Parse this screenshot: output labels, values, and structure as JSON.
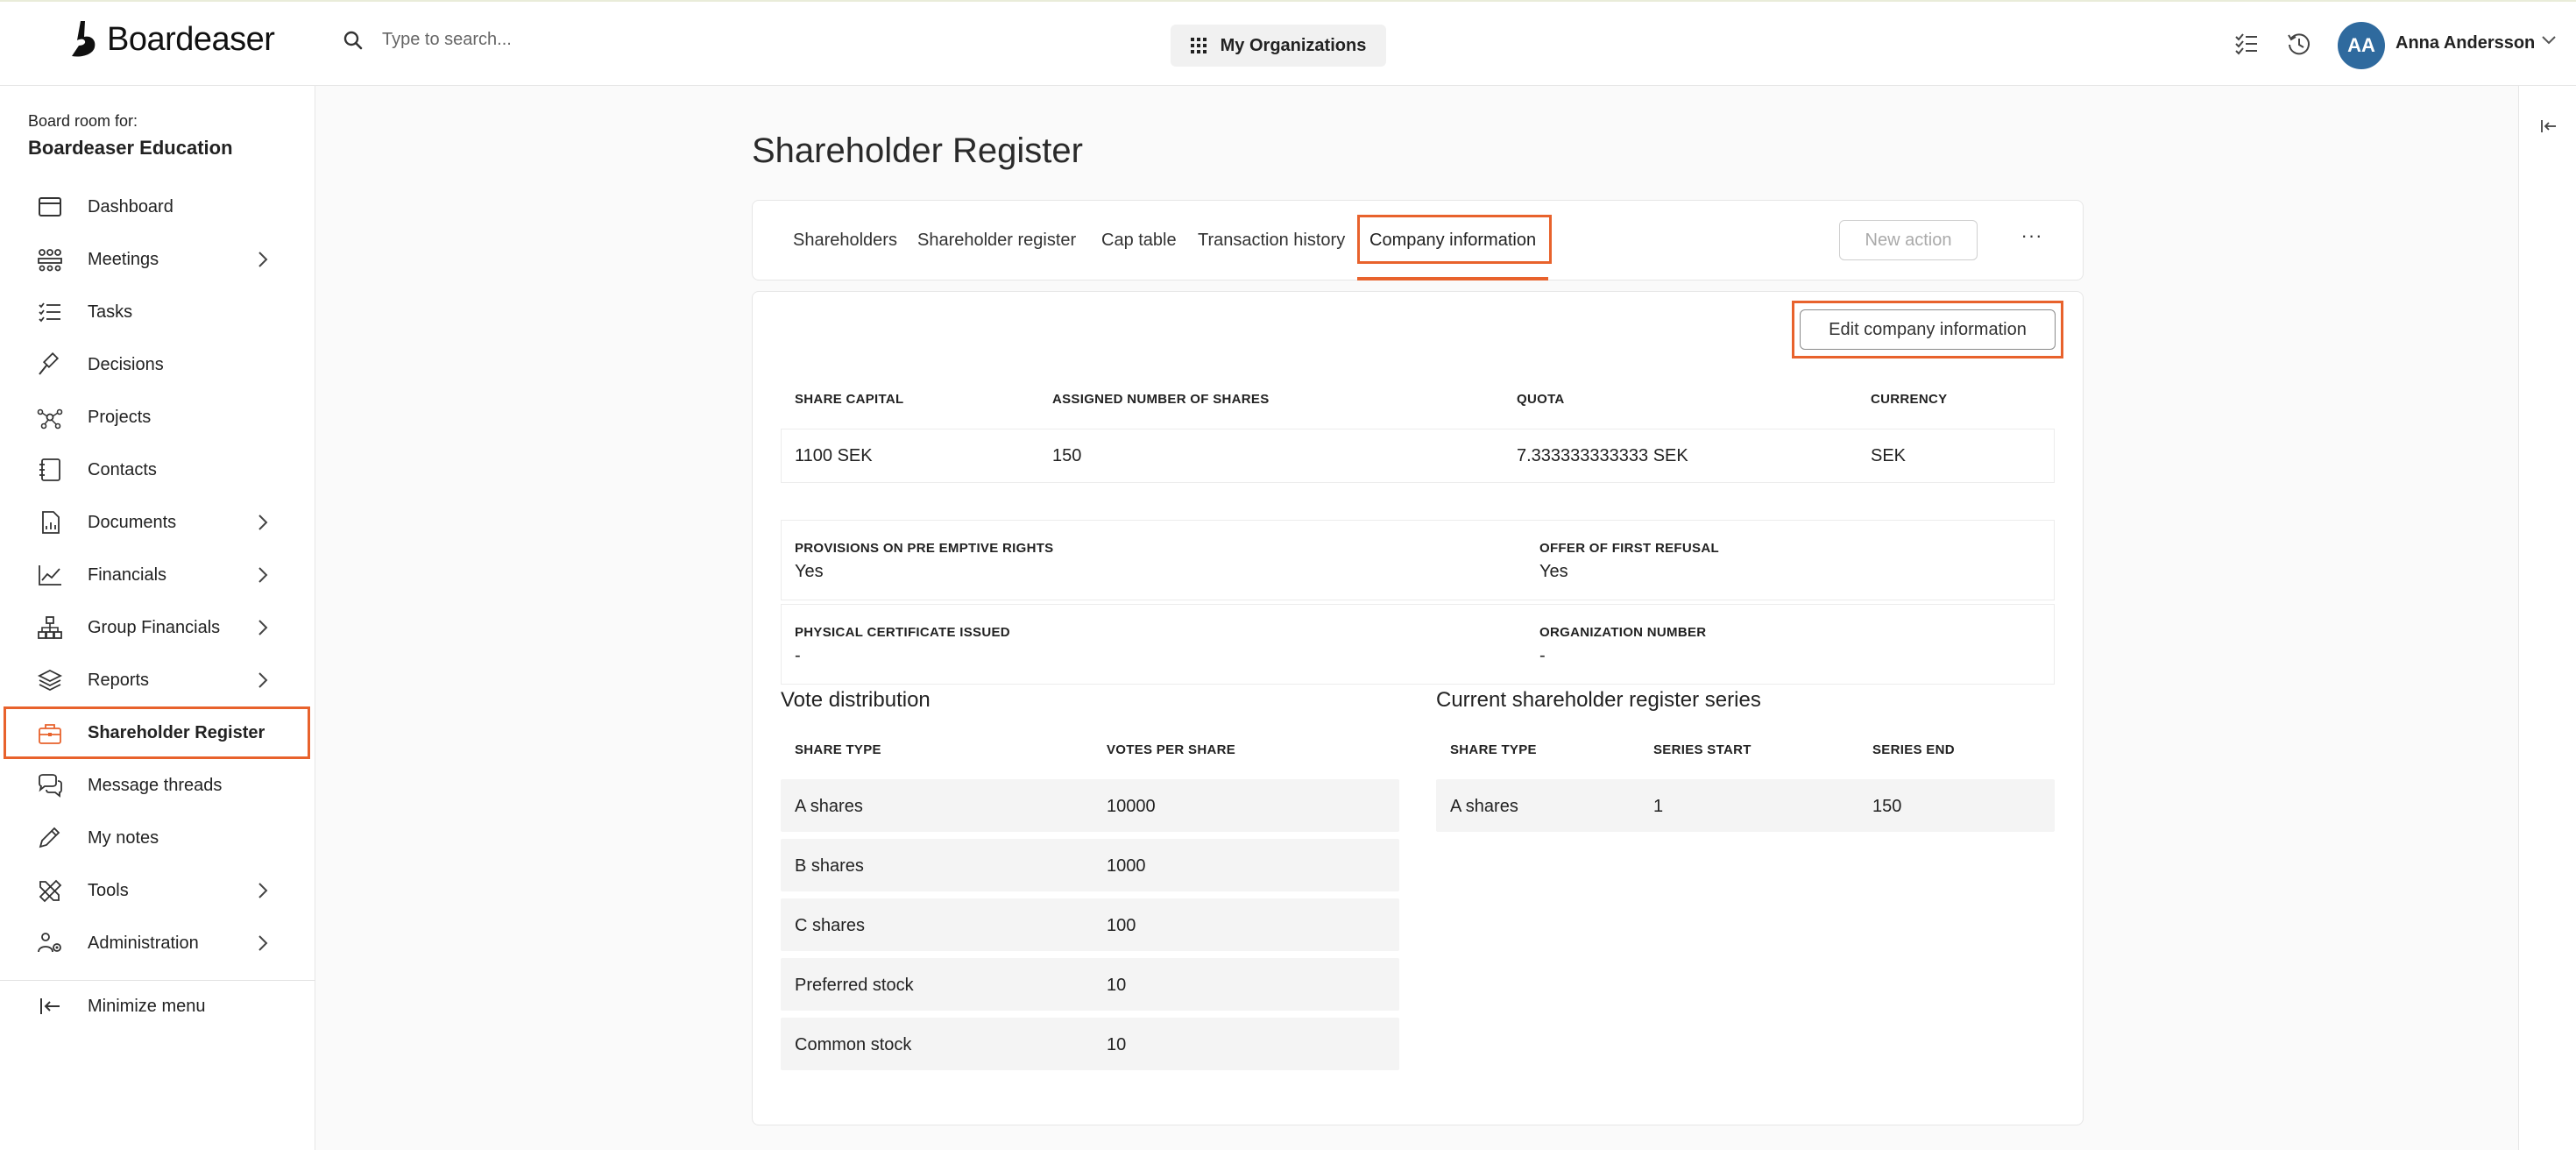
{
  "brand": {
    "name": "Boardeaser"
  },
  "search": {
    "placeholder": "Type to search..."
  },
  "org_switcher": {
    "label": "My Organizations"
  },
  "user": {
    "initials": "AA",
    "name": "Anna Andersson",
    "avatar_color": "#2f6a9e"
  },
  "accent_color": "#e8622c",
  "sidebar": {
    "board_for_label": "Board room for:",
    "board_name": "Boardeaser Education",
    "items": [
      {
        "label": "Dashboard",
        "icon": "dashboard-icon",
        "has_submenu": false
      },
      {
        "label": "Meetings",
        "icon": "meetings-icon",
        "has_submenu": true
      },
      {
        "label": "Tasks",
        "icon": "tasks-icon",
        "has_submenu": false
      },
      {
        "label": "Decisions",
        "icon": "gavel-icon",
        "has_submenu": false
      },
      {
        "label": "Projects",
        "icon": "projects-icon",
        "has_submenu": false
      },
      {
        "label": "Contacts",
        "icon": "contacts-icon",
        "has_submenu": false
      },
      {
        "label": "Documents",
        "icon": "documents-icon",
        "has_submenu": true
      },
      {
        "label": "Financials",
        "icon": "financials-icon",
        "has_submenu": true
      },
      {
        "label": "Group Financials",
        "icon": "group-financials-icon",
        "has_submenu": true
      },
      {
        "label": "Reports",
        "icon": "reports-icon",
        "has_submenu": true
      },
      {
        "label": "Shareholder Register",
        "icon": "briefcase-icon",
        "has_submenu": false,
        "active": true
      },
      {
        "label": "Message threads",
        "icon": "chat-icon",
        "has_submenu": false
      },
      {
        "label": "My notes",
        "icon": "pencil-icon",
        "has_submenu": false
      },
      {
        "label": "Tools",
        "icon": "tools-icon",
        "has_submenu": true
      },
      {
        "label": "Administration",
        "icon": "administration-icon",
        "has_submenu": true
      }
    ],
    "minimize_label": "Minimize menu"
  },
  "page": {
    "title": "Shareholder Register",
    "tabs": [
      {
        "label": "Shareholders"
      },
      {
        "label": "Shareholder register"
      },
      {
        "label": "Cap table"
      },
      {
        "label": "Transaction history"
      },
      {
        "label": "Company information",
        "active": true
      }
    ],
    "new_action_label": "New action",
    "more_label": "···",
    "edit_button_label": "Edit company information"
  },
  "company_info": {
    "headers": {
      "share_capital": "SHARE CAPITAL",
      "assigned_shares": "ASSIGNED NUMBER OF SHARES",
      "quota": "QUOTA",
      "currency": "CURRENCY"
    },
    "values": {
      "share_capital": "1100 SEK",
      "assigned_shares": "150",
      "quota": "7.333333333333 SEK",
      "currency": "SEK"
    },
    "details": [
      {
        "label": "PROVISIONS ON PRE EMPTIVE RIGHTS",
        "value": "Yes"
      },
      {
        "label": "OFFER OF FIRST REFUSAL",
        "value": "Yes"
      },
      {
        "label": "PHYSICAL CERTIFICATE ISSUED",
        "value": "-"
      },
      {
        "label": "ORGANIZATION NUMBER",
        "value": "-"
      }
    ]
  },
  "vote_distribution": {
    "title": "Vote distribution",
    "headers": {
      "share_type": "SHARE TYPE",
      "votes_per_share": "VOTES PER SHARE"
    },
    "rows": [
      {
        "share_type": "A shares",
        "votes": "10000"
      },
      {
        "share_type": "B shares",
        "votes": "1000"
      },
      {
        "share_type": "C shares",
        "votes": "100"
      },
      {
        "share_type": "Preferred stock",
        "votes": "10"
      },
      {
        "share_type": "Common stock",
        "votes": "10"
      }
    ]
  },
  "register_series": {
    "title": "Current shareholder register series",
    "headers": {
      "share_type": "SHARE TYPE",
      "series_start": "SERIES START",
      "series_end": "SERIES END"
    },
    "rows": [
      {
        "share_type": "A shares",
        "series_start": "1",
        "series_end": "150"
      }
    ]
  }
}
